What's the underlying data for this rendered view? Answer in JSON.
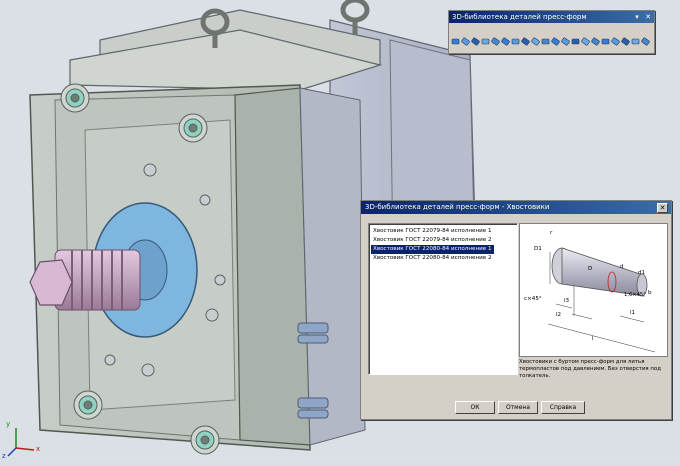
{
  "toolbar_window": {
    "title": "3D-библиотека деталей пресс-форм",
    "controls": [
      "▾",
      "✕"
    ],
    "icons": [
      "bolt-icon",
      "cylinder-icon",
      "pin-icon",
      "sleeve-icon",
      "plate-icon",
      "column-icon",
      "bushing-icon",
      "screw-icon",
      "pin-icon",
      "ejector-icon",
      "rod-icon",
      "bolt-icon",
      "cylinder-icon",
      "pin-icon",
      "spring-icon",
      "screw-icon",
      "ring-icon",
      "rod-icon",
      "bolt-icon",
      "nozzle-icon"
    ]
  },
  "dialog": {
    "title": "3D-библиотека деталей пресс-форм - Хвостовики",
    "close": "✕",
    "items": [
      {
        "label": "Хвостовик ГОСТ 22079-84 исполнение 1",
        "selected": false
      },
      {
        "label": "Хвостовик ГОСТ 22079-84 исполнение 2",
        "selected": false
      },
      {
        "label": "Хвостовик ГОСТ 22080-84 исполнение 1",
        "selected": true
      },
      {
        "label": "Хвостовик ГОСТ 22080-84 исполнение 2",
        "selected": false
      }
    ],
    "preview_dims": [
      "D1",
      "D",
      "d",
      "d1",
      "c×45°",
      "l3",
      "l2",
      "l1",
      "l",
      "b",
      "1,6×45°",
      "r"
    ],
    "description": "Хвостовики с буртом пресс-форм для литья термопластов под давлением. Без отверстия под толкатель.",
    "buttons": {
      "ok": "ОК",
      "cancel": "Отмена",
      "help": "Справка"
    }
  },
  "axes": {
    "x": "x",
    "y": "y",
    "z": "z"
  },
  "colors": {
    "titlebar": "#0a246a",
    "selection": "#0a246a",
    "model_glass": "#b8c2bb",
    "flange": "#7fb6e0",
    "spring": "#c9a6c4",
    "ring": "#8fd1c3"
  }
}
